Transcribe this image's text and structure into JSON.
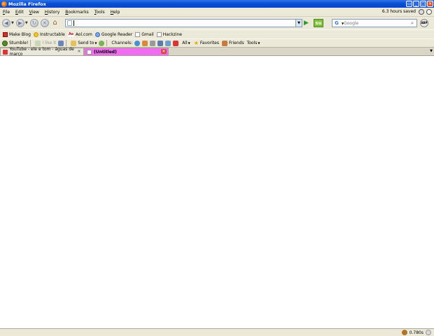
{
  "window": {
    "title": "Mozilla Firefox"
  },
  "menu": {
    "items": [
      "File",
      "Edit",
      "View",
      "History",
      "Bookmarks",
      "Tools",
      "Help"
    ],
    "hours_saved": "6.3 hours saved"
  },
  "nav": {
    "url_value": "",
    "search_placeholder": "Google",
    "search_engine_letter": "G",
    "go_glyph": "▶",
    "abp_label": "ABP"
  },
  "bookmarks": [
    "Make Blog",
    "Instructable",
    "Aol.com",
    "Google Reader",
    "Gmail",
    "Hackzine"
  ],
  "stumble": {
    "stumble_label": "Stumble!",
    "ilike_label": "I like it",
    "sendto_label": "Send to",
    "channels_label": "Channels:",
    "all_label": "All",
    "favorites_label": "Favorites",
    "friends_label": "Friends",
    "tools_label": "Tools"
  },
  "tabs": [
    {
      "title": "YouTube - ele e tom - águas de março"
    },
    {
      "title": "(Untitled)"
    }
  ],
  "status": {
    "time_value": "0.780s"
  },
  "colors": {
    "active_tab": "#f06df0",
    "titlebar": "#0a4fd6",
    "chrome": "#ece9d8"
  }
}
